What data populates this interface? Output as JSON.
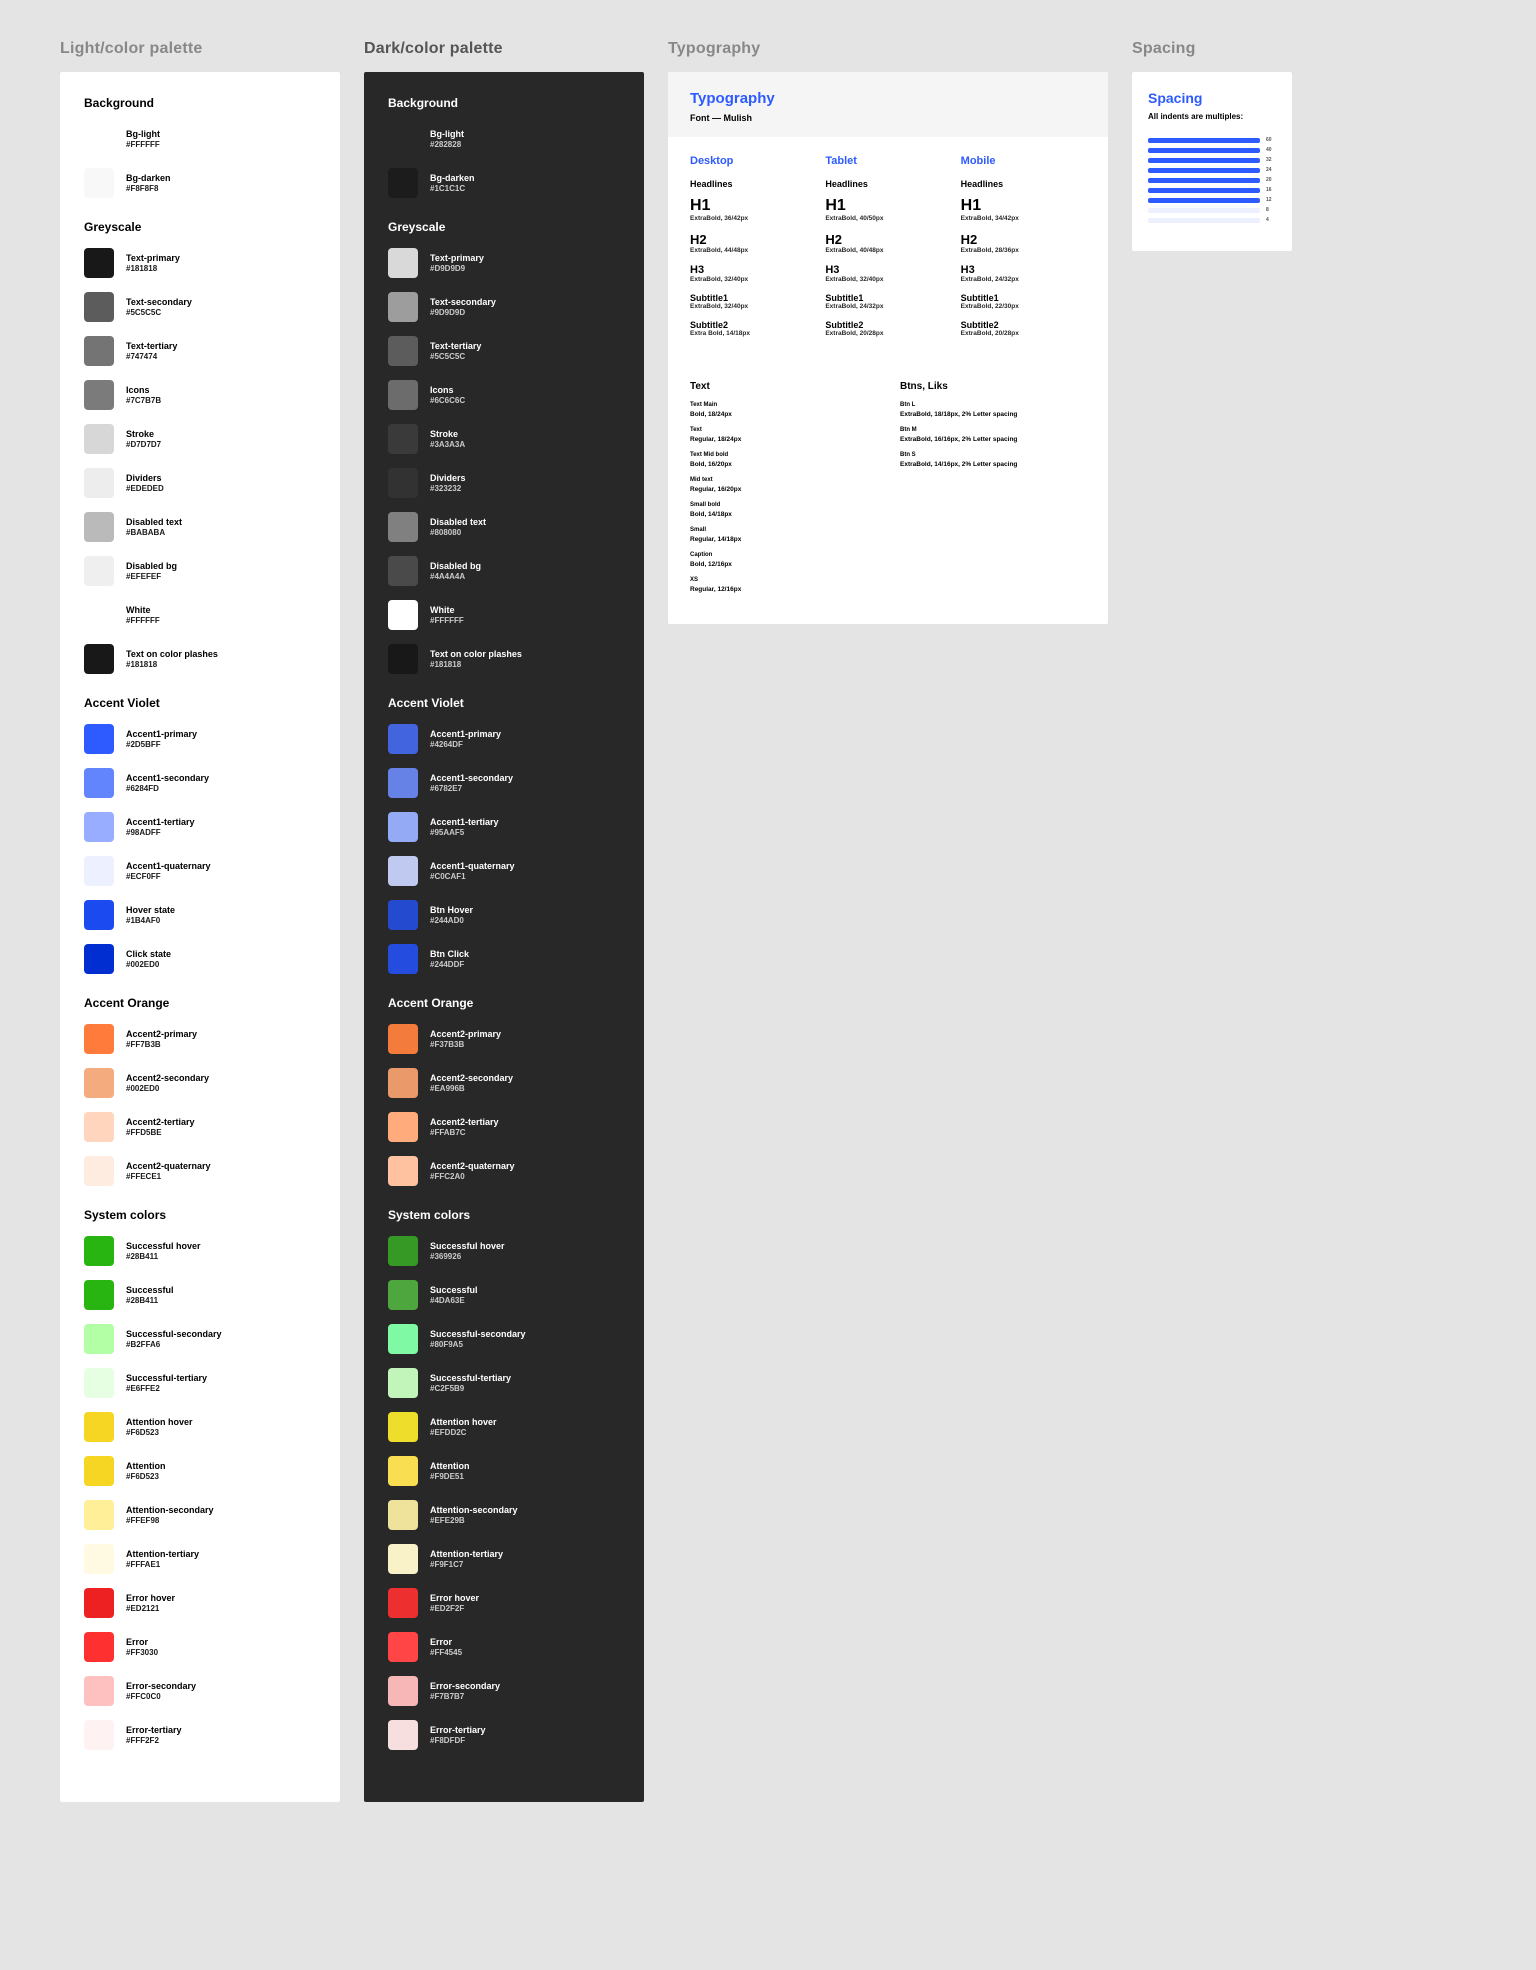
{
  "titles": {
    "light": "Light/color palette",
    "dark": "Dark/color palette",
    "typo": "Typography",
    "spacing": "Spacing"
  },
  "light": {
    "sections": [
      {
        "name": "Background",
        "items": [
          {
            "name": "Bg-light",
            "hex": "#FFFFFF"
          },
          {
            "name": "Bg-darken",
            "hex": "#F8F8F8"
          }
        ]
      },
      {
        "name": "Greyscale",
        "items": [
          {
            "name": "Text-primary",
            "hex": "#181818"
          },
          {
            "name": "Text-secondary",
            "hex": "#5C5C5C"
          },
          {
            "name": "Text-tertiary",
            "hex": "#747474"
          },
          {
            "name": "Icons",
            "hex": "#7C7B7B"
          },
          {
            "name": "Stroke",
            "hex": "#D7D7D7"
          },
          {
            "name": "Dividers",
            "hex": "#EDEDED"
          },
          {
            "name": "Disabled text",
            "hex": "#BABABA"
          },
          {
            "name": "Disabled bg",
            "hex": "#EFEFEF"
          },
          {
            "name": "White",
            "hex": "#FFFFFF"
          },
          {
            "name": "Text on color plashes",
            "hex": "#181818"
          }
        ]
      },
      {
        "name": "Accent Violet",
        "items": [
          {
            "name": "Accent1-primary",
            "hex": "#2D5BFF"
          },
          {
            "name": "Accent1-secondary",
            "hex": "#6284FD"
          },
          {
            "name": "Accent1-tertiary",
            "hex": "#98ADFF"
          },
          {
            "name": "Accent1-quaternary",
            "hex": "#ECF0FF"
          },
          {
            "name": "Hover state",
            "hex": "#1B4AF0"
          },
          {
            "name": "Click state",
            "hex": "#002ED0"
          }
        ]
      },
      {
        "name": "Accent Orange",
        "items": [
          {
            "name": "Accent2-primary",
            "hex": "#FF7B3B"
          },
          {
            "name": "Accent2-secondary",
            "hex": "#002ED0"
          },
          {
            "name": "Accent2-tertiary",
            "hex": "#FFD5BE"
          },
          {
            "name": "Accent2-quaternary",
            "hex": "#FFECE1"
          }
        ]
      },
      {
        "name": "System colors",
        "items": [
          {
            "name": "Successful hover",
            "hex": "#28B411"
          },
          {
            "name": "Successful",
            "hex": "#28B411"
          },
          {
            "name": "Successful-secondary",
            "hex": "#B2FFA6"
          },
          {
            "name": "Successful-tertiary",
            "hex": "#E6FFE2"
          },
          {
            "name": "Attention hover",
            "hex": "#F6D523"
          },
          {
            "name": "Attention",
            "hex": "#F6D523"
          },
          {
            "name": "Attention-secondary",
            "hex": "#FFEF98"
          },
          {
            "name": "Attention-tertiary",
            "hex": "#FFFAE1"
          },
          {
            "name": "Error hover",
            "hex": "#ED2121"
          },
          {
            "name": "Error",
            "hex": "#FF3030"
          },
          {
            "name": "Error-secondary",
            "hex": "#FFC0C0"
          },
          {
            "name": "Error-tertiary",
            "hex": "#FFF2F2"
          }
        ]
      }
    ]
  },
  "dark": {
    "sections": [
      {
        "name": "Background",
        "items": [
          {
            "name": "Bg-light",
            "hex": "#282828"
          },
          {
            "name": "Bg-darken",
            "hex": "#1C1C1C"
          }
        ]
      },
      {
        "name": "Greyscale",
        "items": [
          {
            "name": "Text-primary",
            "hex": "#D9D9D9"
          },
          {
            "name": "Text-secondary",
            "hex": "#9D9D9D"
          },
          {
            "name": "Text-tertiary",
            "hex": "#5C5C5C"
          },
          {
            "name": "Icons",
            "hex": "#6C6C6C"
          },
          {
            "name": "Stroke",
            "hex": "#3A3A3A"
          },
          {
            "name": "Dividers",
            "hex": "#323232"
          },
          {
            "name": "Disabled text",
            "hex": "#808080"
          },
          {
            "name": "Disabled bg",
            "hex": "#4A4A4A"
          },
          {
            "name": "White",
            "hex": "#FFFFFF"
          },
          {
            "name": "Text on color plashes",
            "hex": "#181818"
          }
        ]
      },
      {
        "name": "Accent Violet",
        "items": [
          {
            "name": "Accent1-primary",
            "hex": "#4264DF"
          },
          {
            "name": "Accent1-secondary",
            "hex": "#6782E7"
          },
          {
            "name": "Accent1-tertiary",
            "hex": "#95AAF5"
          },
          {
            "name": "Accent1-quaternary",
            "hex": "#C0CAF1"
          },
          {
            "name": "Btn Hover",
            "hex": "#244AD0"
          },
          {
            "name": "Btn Click",
            "hex": "#244DDF"
          }
        ]
      },
      {
        "name": "Accent Orange",
        "items": [
          {
            "name": "Accent2-primary",
            "hex": "#F37B3B"
          },
          {
            "name": "Accent2-secondary",
            "hex": "#EA996B"
          },
          {
            "name": "Accent2-tertiary",
            "hex": "#FFAB7C"
          },
          {
            "name": "Accent2-quaternary",
            "hex": "#FFC2A0"
          }
        ]
      },
      {
        "name": "System colors",
        "items": [
          {
            "name": "Successful hover",
            "hex": "#369926"
          },
          {
            "name": "Successful",
            "hex": "#4DA63E"
          },
          {
            "name": "Successful-secondary",
            "hex": "#80F9A5"
          },
          {
            "name": "Successful-tertiary",
            "hex": "#C2F5B9"
          },
          {
            "name": "Attention hover",
            "hex": "#EFDD2C"
          },
          {
            "name": "Attention",
            "hex": "#F9DE51"
          },
          {
            "name": "Attention-secondary",
            "hex": "#EFE29B"
          },
          {
            "name": "Attention-tertiary",
            "hex": "#F9F1C7"
          },
          {
            "name": "Error hover",
            "hex": "#ED2F2F"
          },
          {
            "name": "Error",
            "hex": "#FF4545"
          },
          {
            "name": "Error-secondary",
            "hex": "#F7B7B7"
          },
          {
            "name": "Error-tertiary",
            "hex": "#F8DFDF"
          }
        ]
      }
    ]
  },
  "typo": {
    "title": "Typography",
    "font_line": "Font — Mulish",
    "devices": [
      {
        "device": "Desktop",
        "sub": "Headlines",
        "items": [
          {
            "h": "H1",
            "cls": "hl-h1",
            "meta": "ExtraBold, 36/42px"
          },
          {
            "h": "H2",
            "cls": "hl-h2",
            "meta": "ExtraBold, 44/48px"
          },
          {
            "h": "H3",
            "cls": "hl-h3",
            "meta": "ExtraBold, 32/40px"
          },
          {
            "h": "Subtitle1",
            "cls": "hl-st",
            "meta": "ExtraBold, 32/40px"
          },
          {
            "h": "Subtitle2",
            "cls": "hl-st",
            "meta": "Extra Bold, 14/18px"
          }
        ]
      },
      {
        "device": "Tablet",
        "sub": "Headlines",
        "items": [
          {
            "h": "H1",
            "cls": "hl-h1",
            "meta": "ExtraBold, 40/50px"
          },
          {
            "h": "H2",
            "cls": "hl-h2",
            "meta": "ExtraBold, 40/48px"
          },
          {
            "h": "H3",
            "cls": "hl-h3",
            "meta": "ExtraBold, 32/40px"
          },
          {
            "h": "Subtitle1",
            "cls": "hl-st",
            "meta": "ExtraBold, 24/32px"
          },
          {
            "h": "Subtitle2",
            "cls": "hl-st",
            "meta": "ExtraBold, 20/28px"
          }
        ]
      },
      {
        "device": "Mobile",
        "sub": "Headlines",
        "items": [
          {
            "h": "H1",
            "cls": "hl-h1",
            "meta": "ExtraBold, 34/42px"
          },
          {
            "h": "H2",
            "cls": "hl-h2",
            "meta": "ExtraBold, 28/36px"
          },
          {
            "h": "H3",
            "cls": "hl-h3",
            "meta": "ExtraBold, 24/32px"
          },
          {
            "h": "Subtitle1",
            "cls": "hl-st",
            "meta": "ExtraBold, 22/30px"
          },
          {
            "h": "Subtitle2",
            "cls": "hl-st",
            "meta": "ExtraBold, 20/28px"
          }
        ]
      }
    ],
    "text_block": {
      "head": "Text",
      "items": [
        {
          "label": "Text Main",
          "meta": "Bold, 18/24px"
        },
        {
          "label": "Text",
          "meta": "Regular, 18/24px"
        },
        {
          "label": "Text Mid bold",
          "meta": "Bold, 16/20px"
        },
        {
          "label": "Mid text",
          "meta": "Regular, 16/20px"
        },
        {
          "label": "Small bold",
          "meta": "Bold, 14/18px"
        },
        {
          "label": "Small",
          "meta": "Regular, 14/18px"
        },
        {
          "label": "Caption",
          "meta": "Bold, 12/16px"
        },
        {
          "label": "XS",
          "meta": "Regular, 12/16px"
        }
      ]
    },
    "btns_block": {
      "head": "Btns, Liks",
      "items": [
        {
          "label": "Btn L",
          "meta": "ExtraBold, 18/18px, 2% Letter spacing"
        },
        {
          "label": "Btn M",
          "meta": "ExtraBold, 16/16px, 2% Letter spacing"
        },
        {
          "label": "Btn S",
          "meta": "ExtraBold, 14/16px, 2% Letter spacing"
        }
      ]
    }
  },
  "spacing": {
    "title": "Spacing",
    "sub": "All indents are multiples:",
    "rows": [
      {
        "style": "blue",
        "n": "60"
      },
      {
        "style": "blue",
        "n": "40"
      },
      {
        "style": "blue",
        "n": "32"
      },
      {
        "style": "blue",
        "n": "24"
      },
      {
        "style": "blue",
        "n": "20"
      },
      {
        "style": "blue",
        "n": "16"
      },
      {
        "style": "blue",
        "n": "12"
      },
      {
        "style": "pale",
        "n": "8"
      },
      {
        "style": "pale",
        "n": "4"
      }
    ]
  },
  "overrides": {
    "light.Accent Orange.Accent2-secondary": "#F4AC7F"
  }
}
